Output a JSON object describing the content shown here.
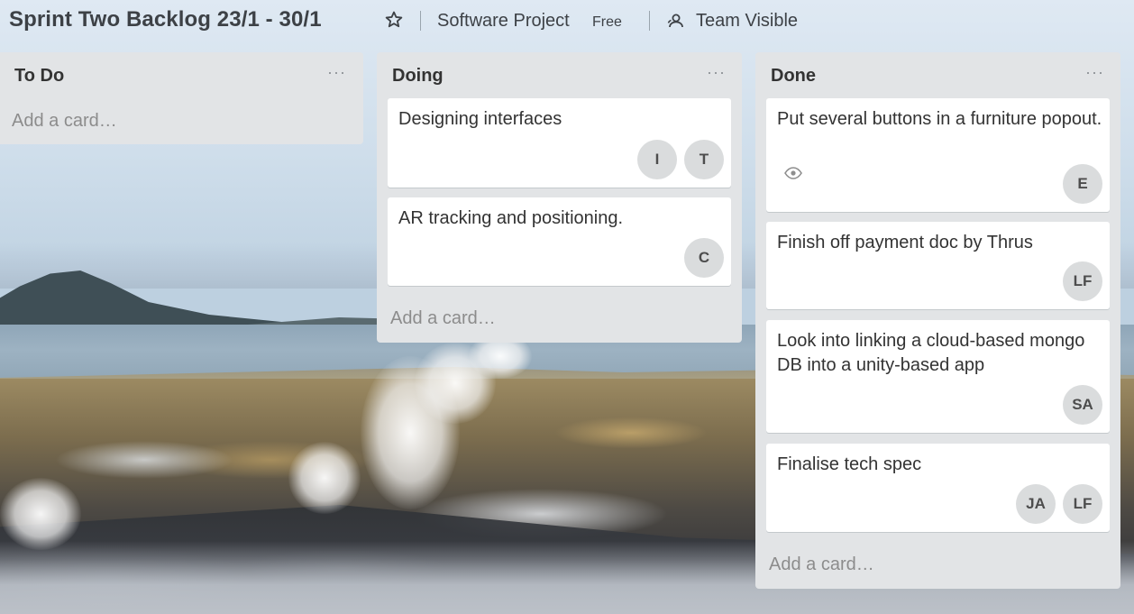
{
  "header": {
    "board_title": "Sprint Two Backlog 23/1 - 30/1",
    "project": "Software Project",
    "plan_badge": "Free",
    "visibility": "Team Visible"
  },
  "icons": {
    "star": "star-icon",
    "team": "team-icon",
    "watch": "eye-icon",
    "list_menu": "ellipsis-icon"
  },
  "lists": [
    {
      "title": "To Do",
      "menu": "···",
      "add_card": "Add a card…",
      "cards": []
    },
    {
      "title": "Doing",
      "menu": "···",
      "add_card": "Add a card…",
      "cards": [
        {
          "title": "Designing interfaces",
          "members": [
            "I",
            "T"
          ]
        },
        {
          "title": "AR tracking and positioning.",
          "members": [
            "C"
          ]
        }
      ]
    },
    {
      "title": "Done",
      "menu": "···",
      "add_card": "Add a card…",
      "cards": [
        {
          "title": "Put several buttons in a furniture popout.",
          "members": [
            "E"
          ],
          "watched": true
        },
        {
          "title": "Finish off payment doc by Thrus",
          "members": [
            "LF"
          ]
        },
        {
          "title": "Look into linking a cloud-based mongo DB into a unity-based app",
          "members": [
            "SA"
          ]
        },
        {
          "title": "Finalise tech spec",
          "members": [
            "JA",
            "LF"
          ]
        }
      ]
    }
  ]
}
